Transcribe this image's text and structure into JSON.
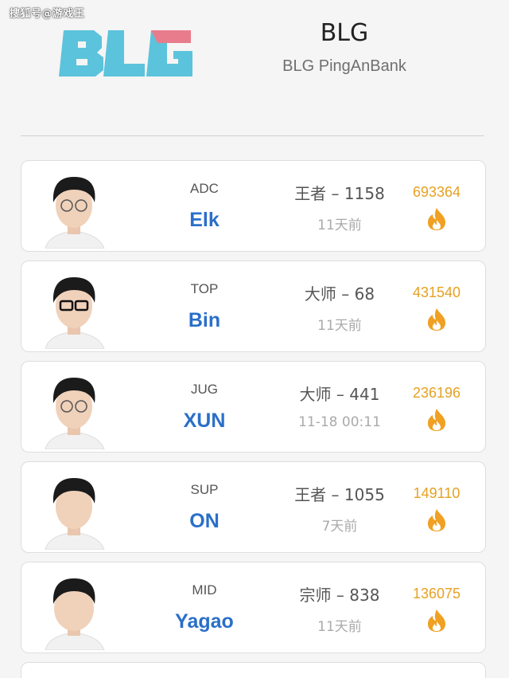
{
  "watermark": "搜狐号@游戏王",
  "team": {
    "name": "BLG",
    "full_name": "BLG PingAnBank",
    "logo_text": "BLG",
    "logo_colors": {
      "primary": "#5cc3dc",
      "accent": "#e97c8c"
    }
  },
  "colors": {
    "name": "#2a6fc9",
    "heat": "#e6a122",
    "fire": "#f0a022"
  },
  "players": [
    {
      "role": "ADC",
      "name": "Elk",
      "rank": "王者 – 1158",
      "time": "11天前",
      "heat": "693364",
      "heat_icon": "fire-icon"
    },
    {
      "role": "TOP",
      "name": "Bin",
      "rank": "大师 – 68",
      "time": "11天前",
      "heat": "431540",
      "heat_icon": "fire-icon"
    },
    {
      "role": "JUG",
      "name": "XUN",
      "rank": "大师 – 441",
      "time": "11-18 00:11",
      "heat": "236196",
      "heat_icon": "fire-icon"
    },
    {
      "role": "SUP",
      "name": "ON",
      "rank": "王者 – 1055",
      "time": "7天前",
      "heat": "149110",
      "heat_icon": "fire-icon"
    },
    {
      "role": "MID",
      "name": "Yagao",
      "rank": "宗师 – 838",
      "time": "11天前",
      "heat": "136075",
      "heat_icon": "fire-icon"
    }
  ]
}
